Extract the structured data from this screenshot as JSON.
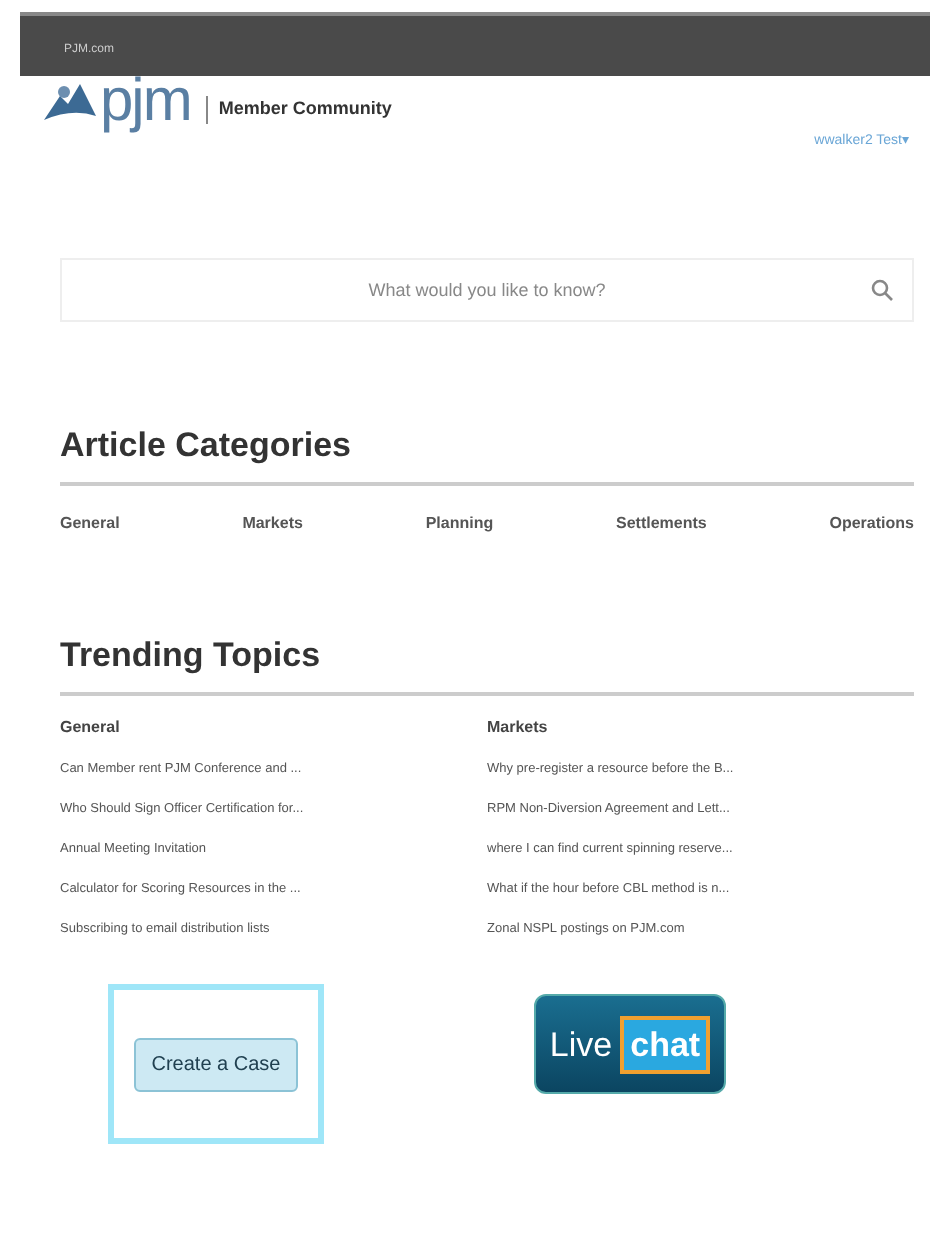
{
  "top_bar": {
    "link": "PJM.com"
  },
  "header": {
    "logo": "pjm",
    "title": "Member Community",
    "user_menu": "wwalker2 Test▾"
  },
  "search": {
    "placeholder": "What would you like to know?"
  },
  "article_categories": {
    "heading": "Article Categories",
    "items": [
      "General",
      "Markets",
      "Planning",
      "Settlements",
      "Operations"
    ]
  },
  "trending_topics": {
    "heading": "Trending Topics",
    "columns": [
      {
        "heading": "General",
        "items": [
          "Can Member rent PJM Conference and ...",
          "Who Should Sign Officer Certification for...",
          "Annual Meeting Invitation",
          "Calculator for Scoring Resources in the ...",
          "Subscribing to email distribution lists"
        ]
      },
      {
        "heading": "Markets",
        "items": [
          "Why pre-register a resource before the B...",
          "RPM Non-Diversion Agreement and Lett...",
          "where I can find current spinning reserve...",
          "What if the hour before CBL method is n...",
          "Zonal NSPL postings on PJM.com"
        ]
      }
    ]
  },
  "actions": {
    "create_case": "Create a Case",
    "live_chat": {
      "word_1": "Live",
      "word_2": "chat"
    }
  }
}
